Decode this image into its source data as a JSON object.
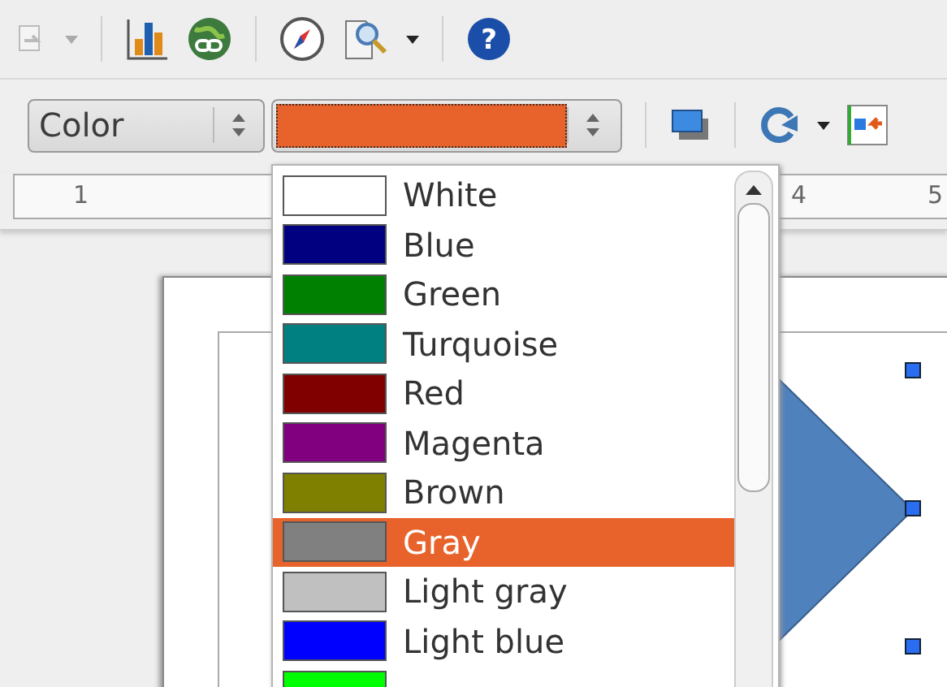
{
  "help_button": {
    "label": "?"
  },
  "area_style": {
    "value": "Color"
  },
  "fill_color": {
    "color": "#e8632b"
  },
  "ruler": {
    "labels": [
      "1",
      "4",
      "5"
    ]
  },
  "color_list": {
    "items": [
      {
        "label": "White",
        "color": "#ffffff",
        "selected": false
      },
      {
        "label": "Blue",
        "color": "#000080",
        "selected": false
      },
      {
        "label": "Green",
        "color": "#008000",
        "selected": false
      },
      {
        "label": "Turquoise",
        "color": "#008080",
        "selected": false
      },
      {
        "label": "Red",
        "color": "#800000",
        "selected": false
      },
      {
        "label": "Magenta",
        "color": "#800080",
        "selected": false
      },
      {
        "label": "Brown",
        "color": "#808000",
        "selected": false
      },
      {
        "label": "Gray",
        "color": "#808080",
        "selected": true
      },
      {
        "label": "Light gray",
        "color": "#c0c0c0",
        "selected": false
      },
      {
        "label": "Light blue",
        "color": "#0000ff",
        "selected": false
      },
      {
        "color": "#00ff00",
        "selected": false
      }
    ]
  }
}
